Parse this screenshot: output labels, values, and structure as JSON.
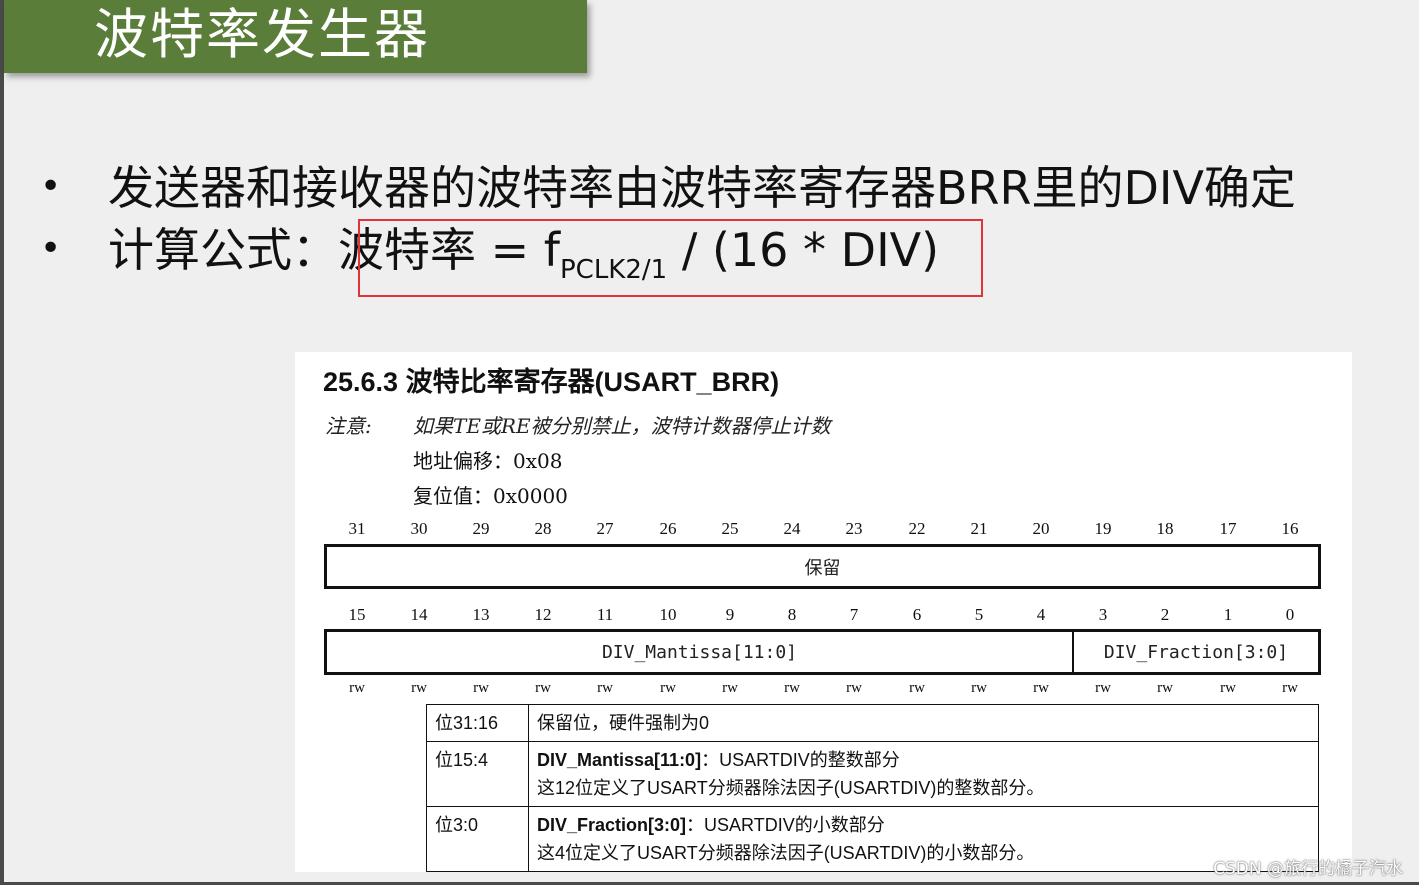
{
  "slide": {
    "title": "波特率发生器",
    "bullet1": "发送器和接收器的波特率由波特率寄存器BRR里的DIV确定",
    "bullet2_prefix": "计算公式：",
    "formula_main": "波特率 = f",
    "formula_sub": "PCLK2/1",
    "formula_tail": " / (16 * DIV)",
    "bullet_symbol": "•"
  },
  "doc": {
    "section_title": "25.6.3   波特比率寄存器(USART_BRR)",
    "note_label": "注意:",
    "note_text": "如果TE或RE被分别禁止，波特计数器停止计数",
    "address": "地址偏移：0x08",
    "reset": "复位值：0x0000",
    "high_bits": [
      "31",
      "30",
      "29",
      "28",
      "27",
      "26",
      "25",
      "24",
      "23",
      "22",
      "21",
      "20",
      "19",
      "18",
      "17",
      "16"
    ],
    "low_bits": [
      "15",
      "14",
      "13",
      "12",
      "11",
      "10",
      "9",
      "8",
      "7",
      "6",
      "5",
      "4",
      "3",
      "2",
      "1",
      "0"
    ],
    "reserved_label": "保留",
    "mantissa_label": "DIV_Mantissa[11:0]",
    "fraction_label": "DIV_Fraction[3:0]",
    "access": [
      "rw",
      "rw",
      "rw",
      "rw",
      "rw",
      "rw",
      "rw",
      "rw",
      "rw",
      "rw",
      "rw",
      "rw",
      "rw",
      "rw",
      "rw",
      "rw"
    ],
    "table": [
      {
        "bit": "位31:16",
        "title": "",
        "line1": "保留位，硬件强制为0",
        "line2": ""
      },
      {
        "bit": "位15:4",
        "title": "DIV_Mantissa[11:0]",
        "line1": "：USARTDIV的整数部分",
        "line2": "这12位定义了USART分频器除法因子(USARTDIV)的整数部分。"
      },
      {
        "bit": "位3:0",
        "title": "DIV_Fraction[3:0]",
        "line1": "：USARTDIV的小数部分",
        "line2": "这4位定义了USART分频器除法因子(USARTDIV)的小数部分。"
      }
    ]
  },
  "watermark": "CSDN @旅行的橘子汽水",
  "colors": {
    "banner": "#5a7d3a",
    "highlight_box": "#e0333a"
  }
}
